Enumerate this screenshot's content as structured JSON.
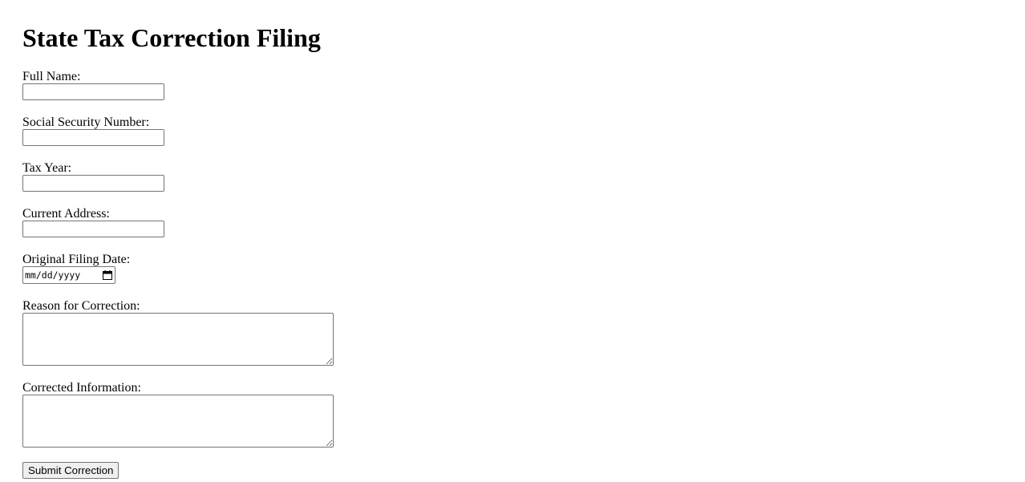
{
  "form": {
    "title": "State Tax Correction Filing",
    "fields": {
      "full_name": {
        "label": "Full Name:",
        "value": ""
      },
      "ssn": {
        "label": "Social Security Number:",
        "value": ""
      },
      "tax_year": {
        "label": "Tax Year:",
        "value": ""
      },
      "current_address": {
        "label": "Current Address:",
        "value": ""
      },
      "original_filing_date": {
        "label": "Original Filing Date:",
        "placeholder": "mm/dd/yyyy",
        "icon": "calendar-icon"
      },
      "reason": {
        "label": "Reason for Correction:",
        "value": ""
      },
      "corrected_info": {
        "label": "Corrected Information:",
        "value": ""
      }
    },
    "submit_label": "Submit Correction"
  }
}
